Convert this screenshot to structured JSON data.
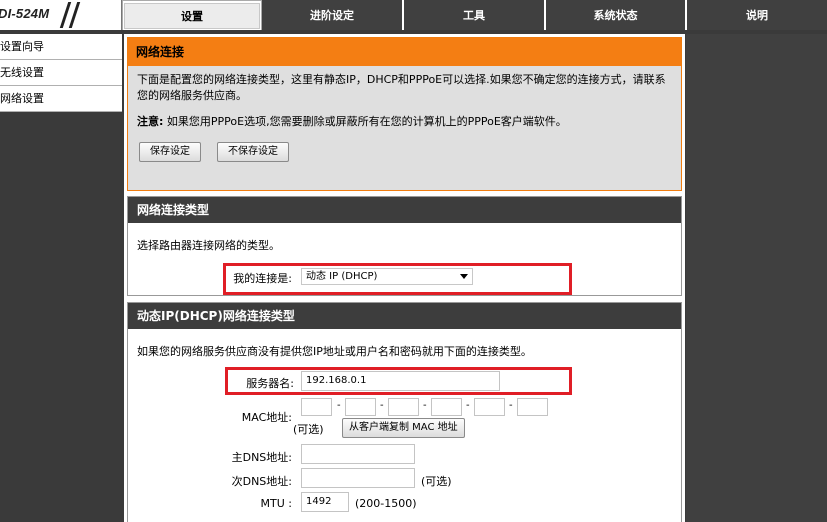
{
  "logo": {
    "text": "DI-524M"
  },
  "tabs": [
    {
      "label": "设置",
      "active": true
    },
    {
      "label": "进阶设定"
    },
    {
      "label": "工具"
    },
    {
      "label": "系统状态"
    },
    {
      "label": "说明"
    }
  ],
  "sidebar": {
    "items": [
      {
        "label": "设置向导"
      },
      {
        "label": "无线设置"
      },
      {
        "label": "网络设置"
      }
    ]
  },
  "intro": {
    "title": "网络连接",
    "text": "下面是配置您的网络连接类型，这里有静态IP，DHCP和PPPoE可以选择.如果您不确定您的连接方式，请联系您的网络服务供应商。",
    "note_prefix": "注意:",
    "note_text": "如果您用PPPoE选项,您需要删除或屏蔽所有在您的计算机上的PPPoE客户端软件。",
    "save_label": "保存设定",
    "nosave_label": "不保存设定"
  },
  "connection_type": {
    "title": "网络连接类型",
    "desc": "选择路由器连接网络的类型。",
    "label": "我的连接是:",
    "selected": "动态 IP (DHCP)"
  },
  "dhcp": {
    "title": "动态IP(DHCP)网络连接类型",
    "desc": "如果您的网络服务供应商没有提供您IP地址或用户名和密码就用下面的连接类型。",
    "server_label": "服务器名:",
    "server_value": "192.168.0.1",
    "mac_label": "MAC地址:",
    "mac_sep": "-",
    "mac_optional": "(可选)",
    "clone_label": "从客户端复制 MAC 地址",
    "dns1_label": "主DNS地址:",
    "dns2_label": "次DNS地址:",
    "dns2_optional": "(可选)",
    "mtu_label": "MTU :",
    "mtu_value": "1492",
    "mtu_range": "(200-1500)"
  },
  "colors": {
    "accent_orange": "#f47e13",
    "header_dark": "#3d3d3d",
    "highlight_red": "#e01e26"
  }
}
